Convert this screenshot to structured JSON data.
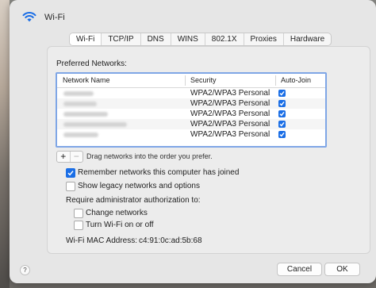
{
  "window": {
    "title": "Wi-Fi"
  },
  "tabs": [
    {
      "label": "Wi-Fi",
      "active": true
    },
    {
      "label": "TCP/IP",
      "active": false
    },
    {
      "label": "DNS",
      "active": false
    },
    {
      "label": "WINS",
      "active": false
    },
    {
      "label": "802.1X",
      "active": false
    },
    {
      "label": "Proxies",
      "active": false
    },
    {
      "label": "Hardware",
      "active": false
    }
  ],
  "preferred": {
    "label": "Preferred Networks:",
    "columns": [
      "Network Name",
      "Security",
      "Auto-Join"
    ],
    "rows": [
      {
        "security": "WPA2/WPA3 Personal",
        "auto_join": true
      },
      {
        "security": "WPA2/WPA3 Personal",
        "auto_join": true
      },
      {
        "security": "WPA2/WPA3 Personal",
        "auto_join": true
      },
      {
        "security": "WPA2/WPA3 Personal",
        "auto_join": true
      },
      {
        "security": "WPA2/WPA3 Personal",
        "auto_join": true
      }
    ],
    "drag_hint": "Drag networks into the order you prefer.",
    "add_symbol": "+",
    "remove_symbol": "−"
  },
  "options": {
    "remember": {
      "label": "Remember networks this computer has joined",
      "checked": true
    },
    "legacy": {
      "label": "Show legacy networks and options",
      "checked": false
    },
    "require_label": "Require administrator authorization to:",
    "change_networks": {
      "label": "Change networks",
      "checked": false
    },
    "turn_wifi": {
      "label": "Turn Wi-Fi on or off",
      "checked": false
    }
  },
  "mac": {
    "label": "Wi-Fi MAC Address:",
    "value": "c4:91:0c:ad:5b:68"
  },
  "footer": {
    "help": "?",
    "cancel": "Cancel",
    "ok": "OK"
  },
  "colors": {
    "accent": "#1a6ee6",
    "focus_ring": "#7fa6e6"
  }
}
